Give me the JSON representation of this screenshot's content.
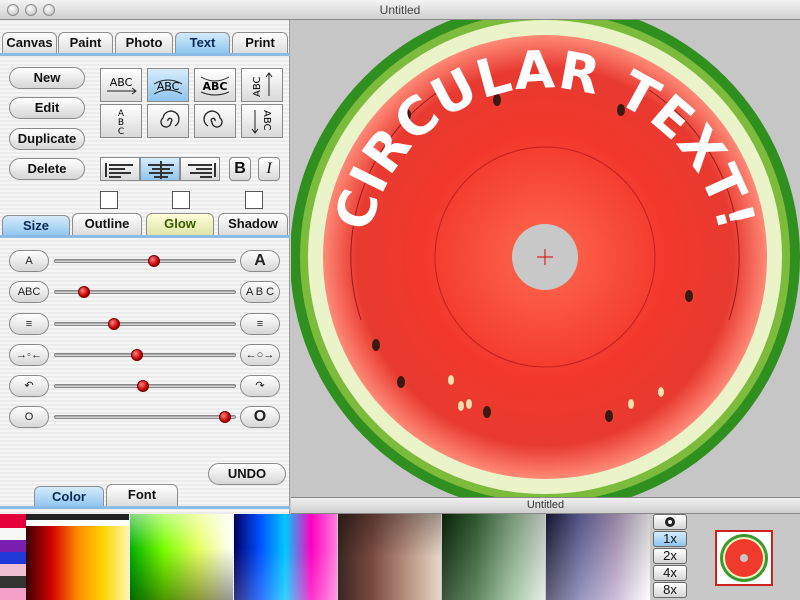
{
  "window": {
    "title": "Untitled"
  },
  "main_tabs": [
    {
      "label": "Canvas",
      "active": false
    },
    {
      "label": "Paint",
      "active": false
    },
    {
      "label": "Photo",
      "active": false
    },
    {
      "label": "Text",
      "active": true
    },
    {
      "label": "Print",
      "active": false
    }
  ],
  "actions": {
    "new": "New",
    "edit": "Edit",
    "duplicate": "Duplicate",
    "delete": "Delete"
  },
  "text_shape_tools": [
    {
      "name": "straight",
      "glyph": "ABC"
    },
    {
      "name": "arc-up",
      "glyph": "ABC",
      "active": true
    },
    {
      "name": "arc-down",
      "glyph": "ABC"
    },
    {
      "name": "vertical-rotated",
      "glyph": "ABC"
    },
    {
      "name": "stacked",
      "glyph": "ABC"
    },
    {
      "name": "spiral",
      "glyph": "@"
    },
    {
      "name": "spiral-alt",
      "glyph": "@"
    },
    {
      "name": "vertical-down",
      "glyph": "ABC"
    }
  ],
  "style_buttons": {
    "bold": "B",
    "italic": "I"
  },
  "sub_tabs": [
    {
      "label": "Size",
      "active": true
    },
    {
      "label": "Outline",
      "active": false
    },
    {
      "label": "Glow",
      "active": false
    },
    {
      "label": "Shadow",
      "active": false
    }
  ],
  "sliders": [
    {
      "name": "size",
      "min_label": "A",
      "max_label": "A",
      "value": 0.55
    },
    {
      "name": "spacing",
      "min_label": "ABC",
      "max_label": "A B C",
      "value": 0.14
    },
    {
      "name": "line-spacing",
      "min_label": "≡",
      "max_label": "≡",
      "value": 0.32
    },
    {
      "name": "radius",
      "min_label": "→◦←",
      "max_label": "←○→",
      "value": 0.45
    },
    {
      "name": "rotation",
      "min_label": "↶",
      "max_label": "↷",
      "value": 0.49
    },
    {
      "name": "opacity",
      "min_label": "O",
      "max_label": "O",
      "value": 0.97
    }
  ],
  "undo": "UNDO",
  "bottom_tabs": [
    {
      "label": "Color",
      "active": true
    },
    {
      "label": "Font",
      "active": false
    }
  ],
  "canvas": {
    "text": "CIRCULAR TEXT!"
  },
  "document_bar": {
    "title": "Untitled"
  },
  "zoom": {
    "levels": [
      "1x",
      "2x",
      "4x",
      "8x"
    ],
    "active": "1x"
  },
  "colors": {
    "accent": "#8cc4ef",
    "slider_knob": "#c40000",
    "watermelon_red": "#e8322a",
    "rind_green": "#2f8f1f"
  }
}
